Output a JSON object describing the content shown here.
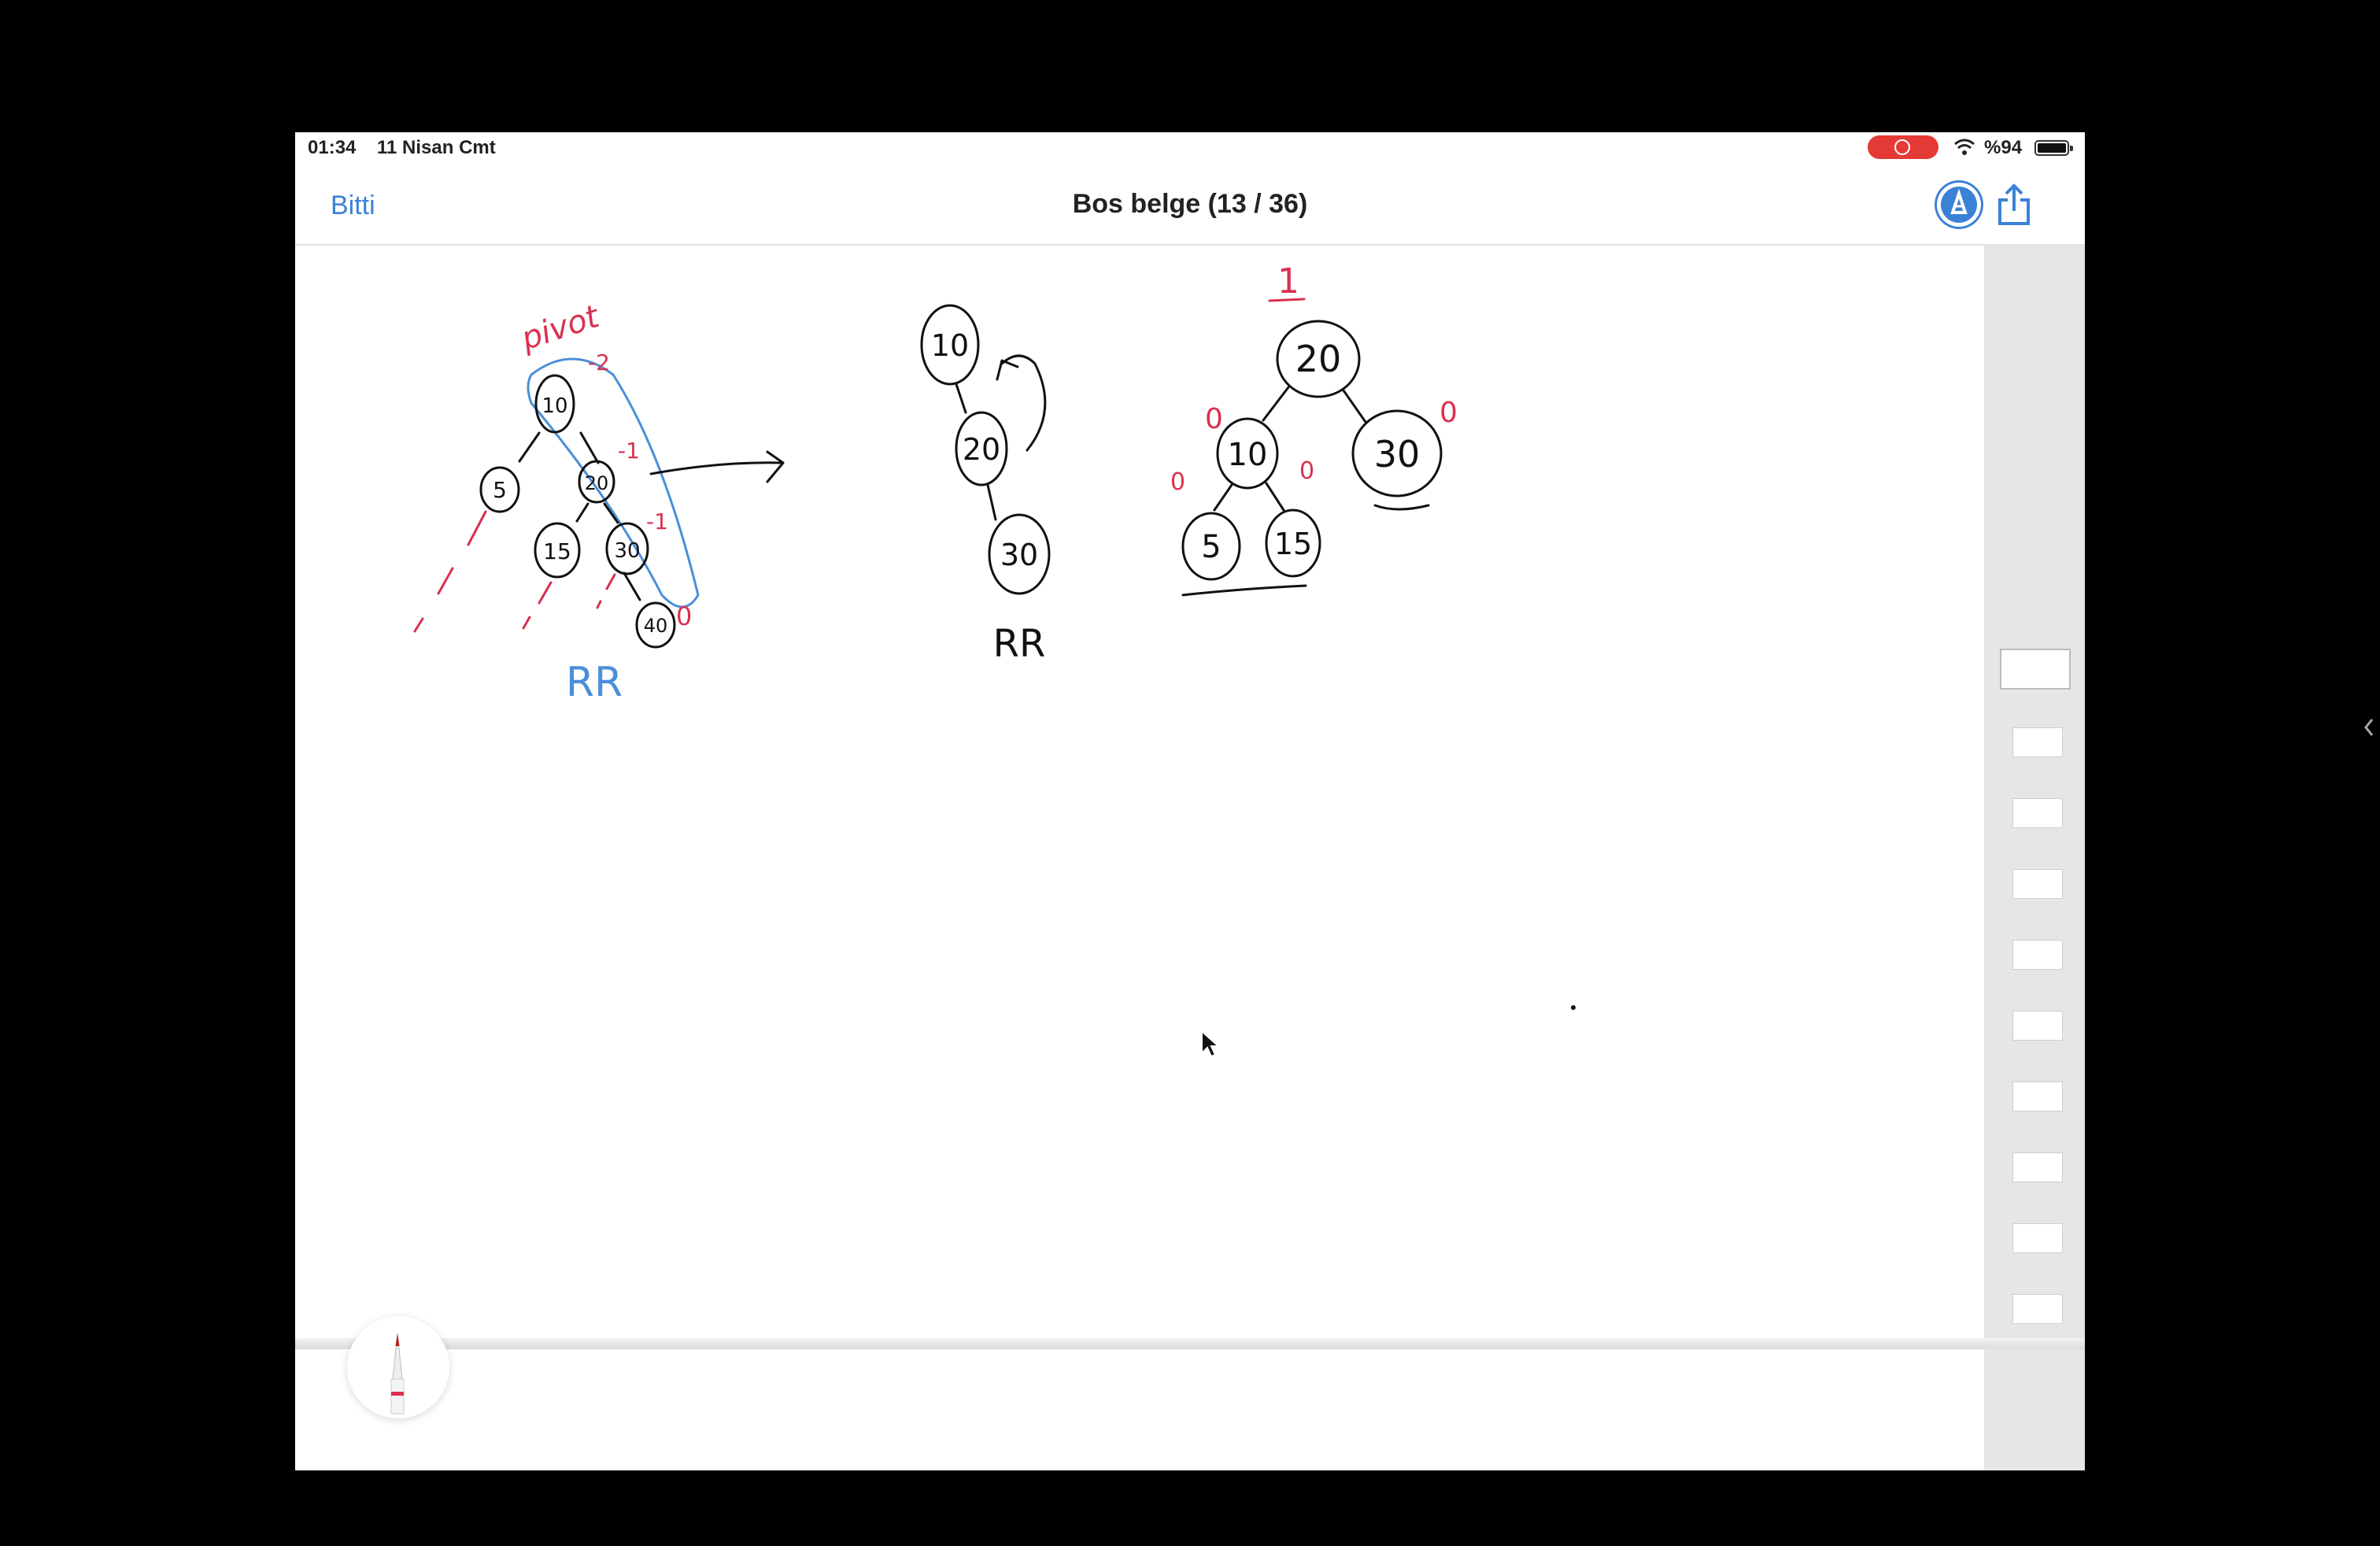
{
  "status_bar": {
    "time": "01:34",
    "date": "11 Nisan Cmt",
    "battery": "%94",
    "record_color": "#e53935"
  },
  "nav_bar": {
    "done_label": "Bitti",
    "title": "Bos belge (13 / 36)",
    "markup_icon": "markup-pen-icon",
    "share_icon": "share-icon",
    "accent": "#3b82d6"
  },
  "canvas": {
    "sketch1": {
      "pivot_label": "pivot",
      "nodes": [
        "10",
        "5",
        "20",
        "15",
        "30",
        "40"
      ],
      "balance": [
        "-2",
        "-1",
        "-1",
        "0"
      ],
      "label": "RR"
    },
    "sketch2": {
      "nodes": [
        "10",
        "20",
        "30"
      ],
      "label": "RR"
    },
    "sketch3": {
      "top_mark": "1",
      "nodes": [
        "20",
        "10",
        "30",
        "5",
        "15"
      ],
      "balance": [
        "0",
        "0",
        "0",
        "0"
      ]
    },
    "ink_black": "#111111",
    "ink_red": "#d9304f",
    "ink_blue": "#4a8fd8"
  },
  "sidebar": {
    "page_thumbnails": 10,
    "active_thumbnail": 1
  },
  "tools": {
    "pencil_icon": "pencil-tool-icon"
  }
}
